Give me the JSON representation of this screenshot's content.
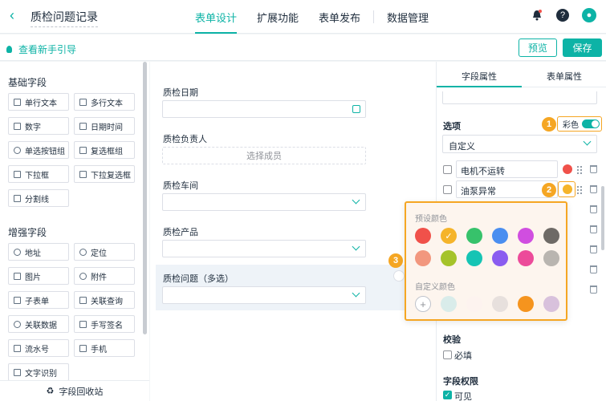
{
  "header": {
    "title": "质检问题记录",
    "tabs": [
      {
        "label": "表单设计",
        "active": true
      },
      {
        "label": "扩展功能",
        "active": false
      },
      {
        "label": "表单发布",
        "active": false
      },
      {
        "label": "数据管理",
        "active": false
      }
    ],
    "icons": [
      "bell-icon",
      "help-icon",
      "user-avatar-icon"
    ]
  },
  "subbar": {
    "guide": "查看新手引导",
    "preview": "预览",
    "save": "保存"
  },
  "left": {
    "basic_title": "基础字段",
    "basic": [
      "单行文本",
      "多行文本",
      "数字",
      "日期时间",
      "单选按钮组",
      "复选框组",
      "下拉框",
      "下拉复选框",
      "分割线"
    ],
    "enhanced_title": "增强字段",
    "enhanced": [
      "地址",
      "定位",
      "图片",
      "附件",
      "子表单",
      "关联查询",
      "关联数据",
      "手写签名",
      "流水号",
      "手机",
      "文字识别"
    ],
    "recycle": "字段回收站"
  },
  "canvas": {
    "fields": [
      {
        "label": "质检日期"
      },
      {
        "label": "质检负责人",
        "placeholder": "选择成员"
      },
      {
        "label": "质检车间"
      },
      {
        "label": "质检产品"
      },
      {
        "label": "质检问题（多选）"
      }
    ]
  },
  "right": {
    "tabs": [
      "字段属性",
      "表单属性"
    ],
    "options_label": "选项",
    "color_label": "彩色",
    "option_mode": "自定义",
    "options": [
      "电机不运转",
      "油泵异常"
    ],
    "option_colors": [
      "#f0514a",
      "#f5b42a"
    ],
    "validation_label": "校验",
    "required_label": "必填",
    "perm_label": "字段权限",
    "visible_label": "可见"
  },
  "popover": {
    "preset_title": "预设颜色",
    "custom_title": "自定义颜色",
    "preset_colors": [
      "#f0514a",
      "#f5b42a",
      "#37c26b",
      "#4a8ef0",
      "#d04ee0",
      "#6e6a66",
      "#f2977e",
      "#a5c32a",
      "#15c4b4",
      "#8a5cf0",
      "#ec4b9a",
      "#b9b5b0"
    ],
    "selected_index": 1,
    "custom_colors": [
      "#d9ecea",
      "#fdf3ef",
      "#e7e0dd",
      "#f5941e",
      "#d8c1dc"
    ],
    "add_symbol": "+"
  },
  "badges": [
    "1",
    "2",
    "3"
  ],
  "accent": "#0db3a6",
  "highlight": "#f5a623"
}
